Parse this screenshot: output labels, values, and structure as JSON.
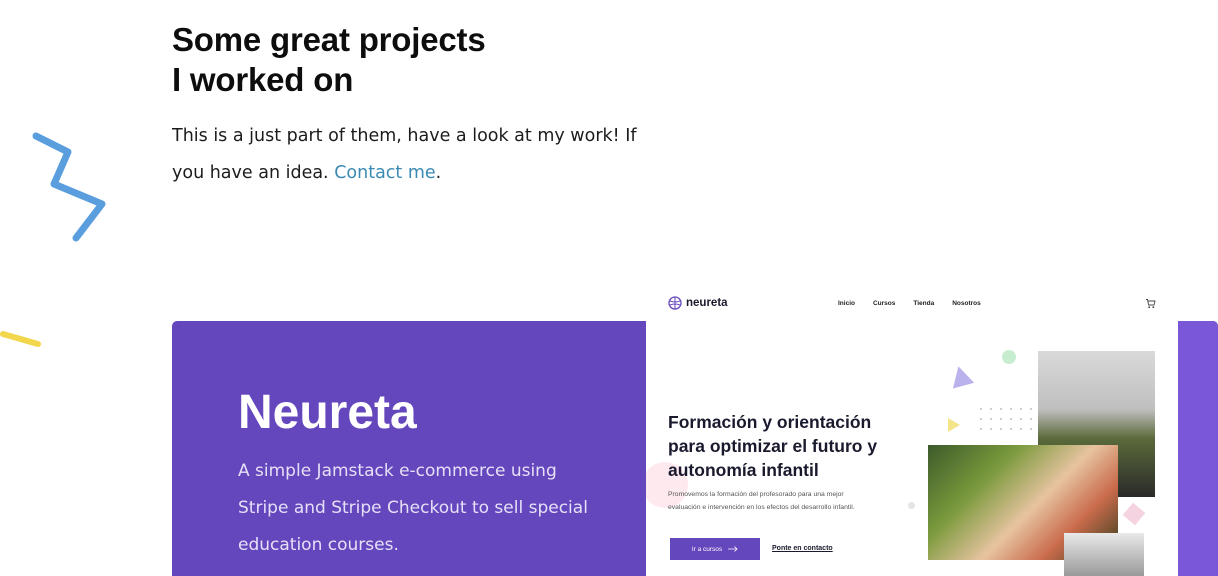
{
  "intro": {
    "title_line1": "Some great projects",
    "title_line2": "I worked on",
    "text_before_link": "This is a just part of them, have a look at my work! If you have an idea. ",
    "link_text": "Contact me",
    "text_after_link": "."
  },
  "project": {
    "title": "Neureta",
    "description": "A simple Jamstack e-commerce using Stripe and Stripe Checkout to sell special education courses."
  },
  "preview": {
    "brand": "neureta",
    "menu": [
      "Inicio",
      "Cursos",
      "Tienda",
      "Nosotros"
    ],
    "heading": "Formación y orientación para optimizar el futuro  y autonomía infantil",
    "subtext": "Promovemos la formación del profesorado para una mejor evaluación e intervención en los efectos del desarrollo infantil.",
    "cta_label": "Ir a cursos",
    "contact_label": "Ponte en contacto"
  },
  "icons": {
    "cart": "cart-icon",
    "logo": "brain-logo-icon",
    "arrow": "arrow-right-icon"
  },
  "colors": {
    "card": "#6547bd",
    "link": "#3a8ab4",
    "zigzag": "#5a9ede",
    "dash": "#f2d64b"
  }
}
